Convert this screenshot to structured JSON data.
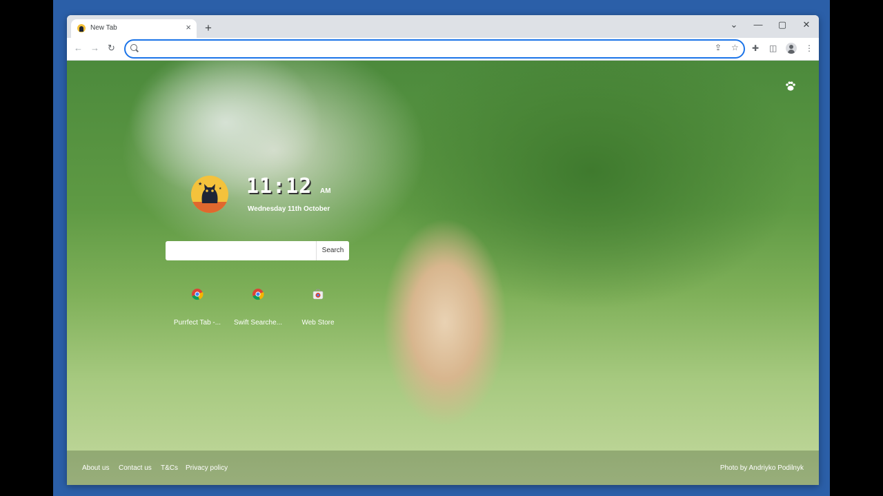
{
  "browser": {
    "tab_title": "New Tab",
    "tab_close": "×",
    "new_tab": "+",
    "window_controls": {
      "menu": "⌄",
      "minimize": "—",
      "maximize": "▢",
      "close": "✕"
    },
    "nav": {
      "back": "←",
      "forward": "→",
      "reload": "↻"
    },
    "omnibox": {
      "value": "",
      "placeholder": ""
    },
    "toolbar_icons": [
      "share-icon",
      "bookmark-star-icon",
      "extensions-icon",
      "side-panel-icon",
      "profile-icon",
      "menu-icon"
    ]
  },
  "newtab": {
    "clock_time": "11:12",
    "clock_ampm": "AM",
    "date": "Wednesday 11th October",
    "search": {
      "value": "",
      "button": "Search"
    },
    "shortcuts": [
      {
        "label": "Purrfect Tab -...",
        "icon": "chrome-icon"
      },
      {
        "label": "Swift Searche...",
        "icon": "chrome-icon"
      },
      {
        "label": "Web Store",
        "icon": "web-store-icon"
      }
    ],
    "footer_links": [
      "About us",
      "Contact us",
      "T&Cs",
      "Privacy policy"
    ],
    "photo_credit": "Photo by Andriyko Podilnyk"
  },
  "colors": {
    "desktop": "#2b5fa8",
    "tabstrip": "#dee1e6",
    "omnibox_focus": "#1a73e8"
  }
}
